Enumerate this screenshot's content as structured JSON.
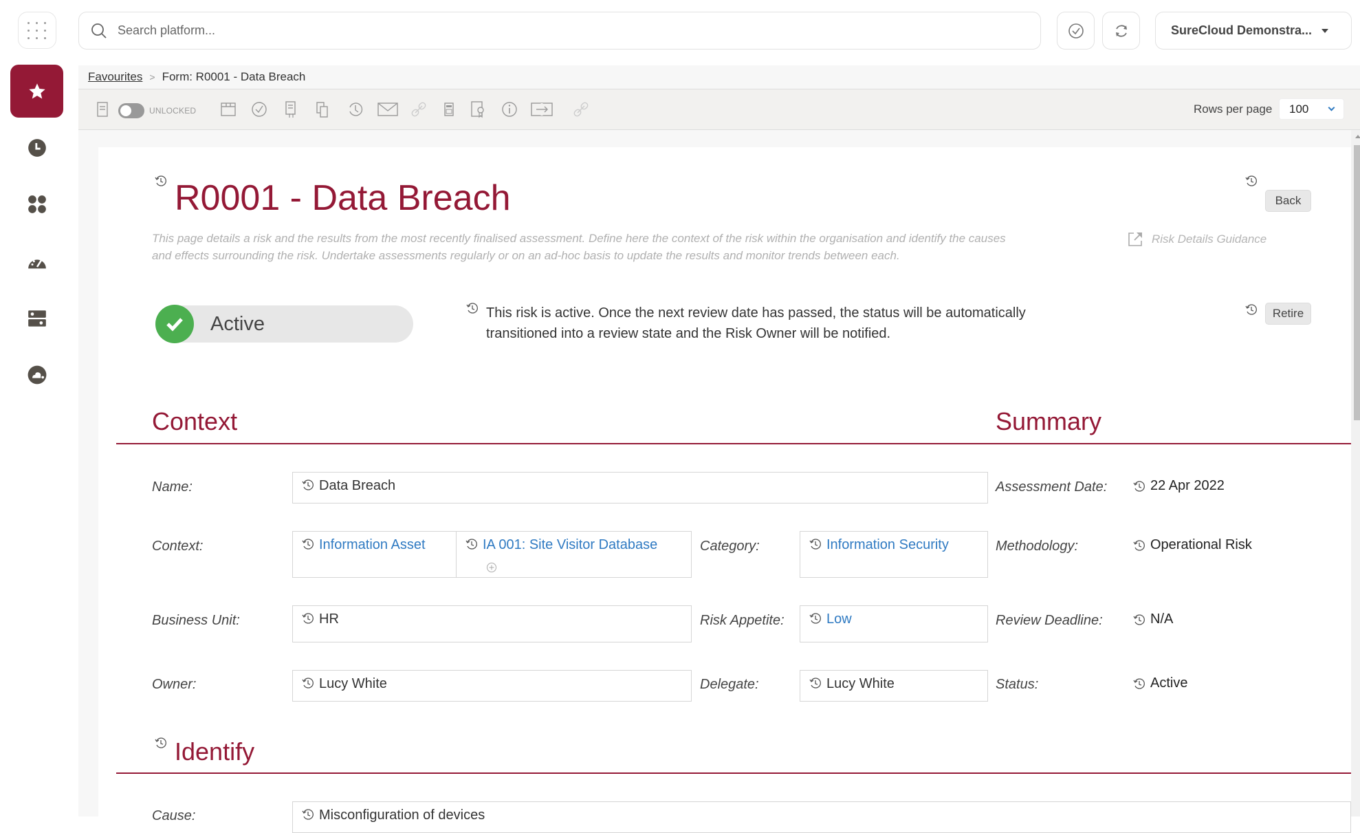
{
  "topbar": {
    "search_placeholder": "Search platform...",
    "org_selector": "SureCloud Demonstra..."
  },
  "sidebar": {
    "items": [
      {
        "name": "favourites",
        "icon": "star-icon",
        "active": true
      },
      {
        "name": "recent",
        "icon": "clock-icon",
        "active": false
      },
      {
        "name": "apps",
        "icon": "grid-dots-icon",
        "active": false
      },
      {
        "name": "dashboards",
        "icon": "gauge-icon",
        "active": false
      },
      {
        "name": "data",
        "icon": "server-icon",
        "active": false
      },
      {
        "name": "cloud",
        "icon": "cloud-icon",
        "active": false
      }
    ]
  },
  "breadcrumb": {
    "root": "Favourites",
    "separator": ">",
    "current": "Form: R0001 - Data Breach"
  },
  "toolbar": {
    "lock_label": "UNLOCKED",
    "rows_per_page_label": "Rows per page",
    "rows_per_page_value": "100",
    "icons": [
      "form-icon",
      "lock-toggle",
      "layout-icon",
      "check-circle-icon",
      "import-export-icon",
      "copy-icon",
      "history-icon",
      "email-icon",
      "link-icon",
      "calculator-icon",
      "certificate-icon",
      "info-icon",
      "transfer-icon",
      "link-icon"
    ]
  },
  "page": {
    "title": "R0001 - Data Breach",
    "intro": "This page details a risk and the results from the most recently finalised assessment. Define here the context of the risk within the organisation and identify the causes and effects surrounding the risk. Undertake assessments regularly or on an ad-hoc basis to update the results and monitor trends between each.",
    "guidance_link": "Risk Details Guidance",
    "back_button": "Back",
    "retire_button": "Retire",
    "status": {
      "label": "Active",
      "description": "This risk is active. Once the next review date has passed, the status will be automatically transitioned into a review state and the Risk Owner will be notified.",
      "color": "#4caf50"
    }
  },
  "context": {
    "heading": "Context",
    "fields": {
      "name": {
        "label": "Name:",
        "value": "Data Breach"
      },
      "context": {
        "label": "Context:",
        "value_type": "Information Asset",
        "value_item": "IA 001: Site Visitor Database"
      },
      "category": {
        "label": "Category:",
        "value": "Information Security"
      },
      "business_unit": {
        "label": "Business Unit:",
        "value": "HR"
      },
      "risk_appetite": {
        "label": "Risk Appetite:",
        "value": "Low"
      },
      "owner": {
        "label": "Owner:",
        "value": "Lucy White"
      },
      "delegate": {
        "label": "Delegate:",
        "value": "Lucy White"
      }
    }
  },
  "summary": {
    "heading": "Summary",
    "fields": {
      "assessment_date": {
        "label": "Assessment Date:",
        "value": "22 Apr 2022"
      },
      "methodology": {
        "label": "Methodology:",
        "value": "Operational Risk"
      },
      "review_deadline": {
        "label": "Review Deadline:",
        "value": "N/A"
      },
      "status": {
        "label": "Status:",
        "value": "Active"
      }
    }
  },
  "identify": {
    "heading": "Identify",
    "fields": {
      "cause": {
        "label": "Cause:",
        "value": "Misconfiguration of devices"
      }
    }
  },
  "colors": {
    "brand": "#941936",
    "link": "#2f7ac2",
    "active_green": "#4caf50"
  }
}
